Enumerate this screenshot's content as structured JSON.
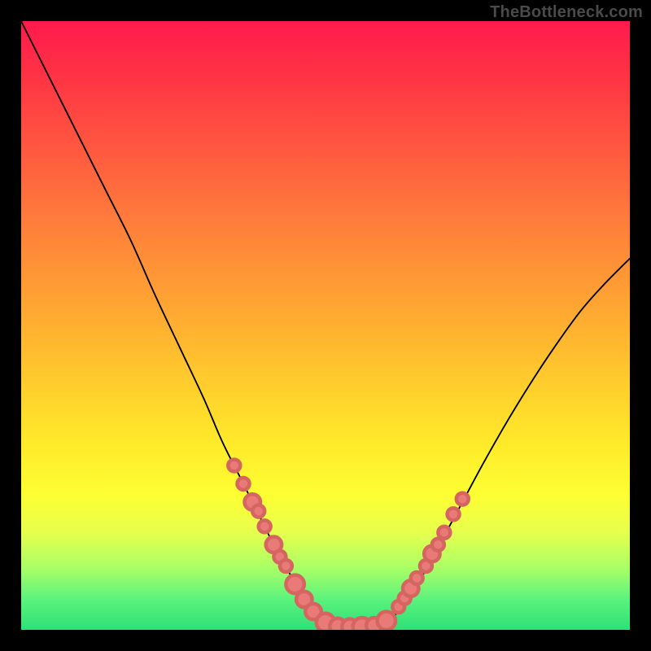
{
  "watermark": "TheBottleneck.com",
  "colors": {
    "dot_fill": "#ea7a77",
    "dot_stroke": "#d46561",
    "curve": "#000000",
    "gradient_top": "#ff1a4d",
    "gradient_bottom": "#2ee077",
    "frame": "#000000"
  },
  "chart_data": {
    "type": "line",
    "title": "",
    "xlabel": "",
    "ylabel": "",
    "xlim": [
      0,
      100
    ],
    "ylim": [
      0,
      100
    ],
    "grid": false,
    "legend": null,
    "annotations": [
      "TheBottleneck.com"
    ],
    "series": [
      {
        "name": "left_branch",
        "x": [
          0.0,
          3.0,
          6.0,
          10.0,
          14.0,
          18.0,
          22.0,
          26.0,
          30.0,
          33.0,
          36.0,
          39.0,
          41.5,
          43.5,
          45.0,
          47.0,
          49.0,
          51.0
        ],
        "y": [
          100,
          94.0,
          88.0,
          80.0,
          72.0,
          64.0,
          55.0,
          46.5,
          38.0,
          31.0,
          25.0,
          19.0,
          14.0,
          10.5,
          7.5,
          4.5,
          2.0,
          0.8
        ]
      },
      {
        "name": "valley_floor",
        "x": [
          51.0,
          53.0,
          55.0,
          57.0,
          59.0
        ],
        "y": [
          0.8,
          0.4,
          0.3,
          0.4,
          0.7
        ]
      },
      {
        "name": "right_branch",
        "x": [
          59.0,
          61.0,
          63.5,
          66.0,
          69.0,
          72.5,
          76.0,
          80.0,
          84.0,
          88.0,
          92.0,
          96.0,
          100.0
        ],
        "y": [
          0.7,
          2.0,
          5.0,
          9.0,
          14.5,
          21.0,
          27.5,
          34.5,
          41.0,
          47.0,
          52.5,
          57.0,
          61.0
        ]
      }
    ],
    "scatter": {
      "name": "markers",
      "points": [
        {
          "x": 35.0,
          "y": 27.0,
          "r": 1.0
        },
        {
          "x": 36.5,
          "y": 24.0,
          "r": 1.0
        },
        {
          "x": 38.0,
          "y": 21.0,
          "r": 1.3
        },
        {
          "x": 39.0,
          "y": 19.5,
          "r": 1.0
        },
        {
          "x": 40.0,
          "y": 17.0,
          "r": 1.0
        },
        {
          "x": 41.5,
          "y": 14.0,
          "r": 1.3
        },
        {
          "x": 42.5,
          "y": 12.0,
          "r": 1.0
        },
        {
          "x": 43.5,
          "y": 10.5,
          "r": 1.0
        },
        {
          "x": 45.0,
          "y": 7.5,
          "r": 1.5
        },
        {
          "x": 46.5,
          "y": 5.0,
          "r": 1.3
        },
        {
          "x": 48.0,
          "y": 3.0,
          "r": 1.3
        },
        {
          "x": 50.0,
          "y": 1.2,
          "r": 1.5
        },
        {
          "x": 52.0,
          "y": 0.6,
          "r": 1.3
        },
        {
          "x": 54.0,
          "y": 0.5,
          "r": 1.3
        },
        {
          "x": 56.0,
          "y": 0.5,
          "r": 1.5
        },
        {
          "x": 58.0,
          "y": 0.7,
          "r": 1.3
        },
        {
          "x": 60.0,
          "y": 1.5,
          "r": 1.5
        },
        {
          "x": 62.0,
          "y": 3.8,
          "r": 1.0
        },
        {
          "x": 63.0,
          "y": 5.2,
          "r": 1.0
        },
        {
          "x": 64.0,
          "y": 6.8,
          "r": 1.3
        },
        {
          "x": 65.0,
          "y": 8.5,
          "r": 1.0
        },
        {
          "x": 66.5,
          "y": 10.5,
          "r": 1.0
        },
        {
          "x": 67.5,
          "y": 12.5,
          "r": 1.3
        },
        {
          "x": 68.5,
          "y": 14.0,
          "r": 1.0
        },
        {
          "x": 69.5,
          "y": 16.0,
          "r": 1.0
        },
        {
          "x": 71.0,
          "y": 19.0,
          "r": 1.0
        },
        {
          "x": 72.5,
          "y": 21.5,
          "r": 1.0
        }
      ]
    }
  }
}
